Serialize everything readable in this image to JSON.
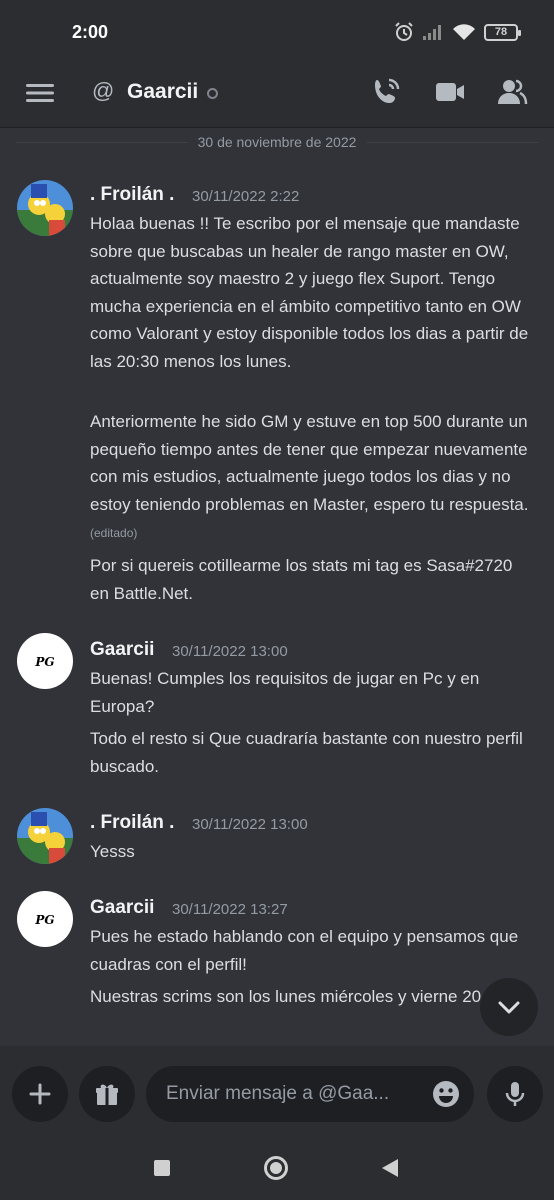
{
  "status_bar": {
    "time": "2:00",
    "battery": "78",
    "icons": [
      "alarm-icon",
      "signal-icon",
      "wifi-icon",
      "battery-icon"
    ]
  },
  "header": {
    "channel_name": "Gaarcii",
    "icons": [
      "menu-icon",
      "at-icon",
      "call-icon",
      "video-icon",
      "members-icon"
    ]
  },
  "chat": {
    "date_divider": "30 de noviembre de 2022",
    "messages": [
      {
        "author": ". Froilán .",
        "timestamp": "30/11/2022 2:22",
        "paragraphs": [
          "Holaa buenas !! Te escribo por el mensaje que mandaste sobre que buscabas un healer de rango master en OW, actualmente soy maestro 2 y juego flex Suport. Tengo mucha experiencia en el ámbito competitivo tanto en OW como Valorant y estoy disponible todos los dias a partir de las 20:30 menos los lunes.",
          "Anteriormente he sido GM y estuve en top 500 durante un pequeño tiempo antes de tener que empezar nuevamente con mis estudios, actualmente juego todos los dias y no estoy teniendo problemas en Master, espero tu respuesta.",
          "Por si quereis cotillearme los stats mi tag es Sasa#2720 en Battle.Net."
        ],
        "edited_label": "(editado)"
      },
      {
        "author": "Gaarcii",
        "timestamp": "30/11/2022 13:00",
        "avatar_text": "PG",
        "paragraphs": [
          "Buenas! Cumples los requisitos de jugar en Pc y en Europa?",
          "Todo el resto si Que cuadraría bastante con nuestro perfil buscado."
        ]
      },
      {
        "author": ". Froilán .",
        "timestamp": "30/11/2022 13:00",
        "paragraphs": [
          "Yesss"
        ]
      },
      {
        "author": "Gaarcii",
        "timestamp": "30/11/2022 13:27",
        "avatar_text": "PG",
        "paragraphs": [
          "Pues he estado hablando con el equipo y pensamos que cuadras con el perfil!",
          "Nuestras scrims son los lunes miércoles y vierne 20 a 22"
        ]
      }
    ]
  },
  "composer": {
    "placeholder": "Enviar mensaje a @Gaa...",
    "icons": [
      "plus-icon",
      "gift-icon",
      "emoji-icon",
      "mic-icon"
    ]
  },
  "colors": {
    "background": "#313338",
    "header_bg": "#2b2d31",
    "input_bg": "#1e1f22",
    "text_primary": "#f2f3f5",
    "text_muted": "#949ba4"
  }
}
